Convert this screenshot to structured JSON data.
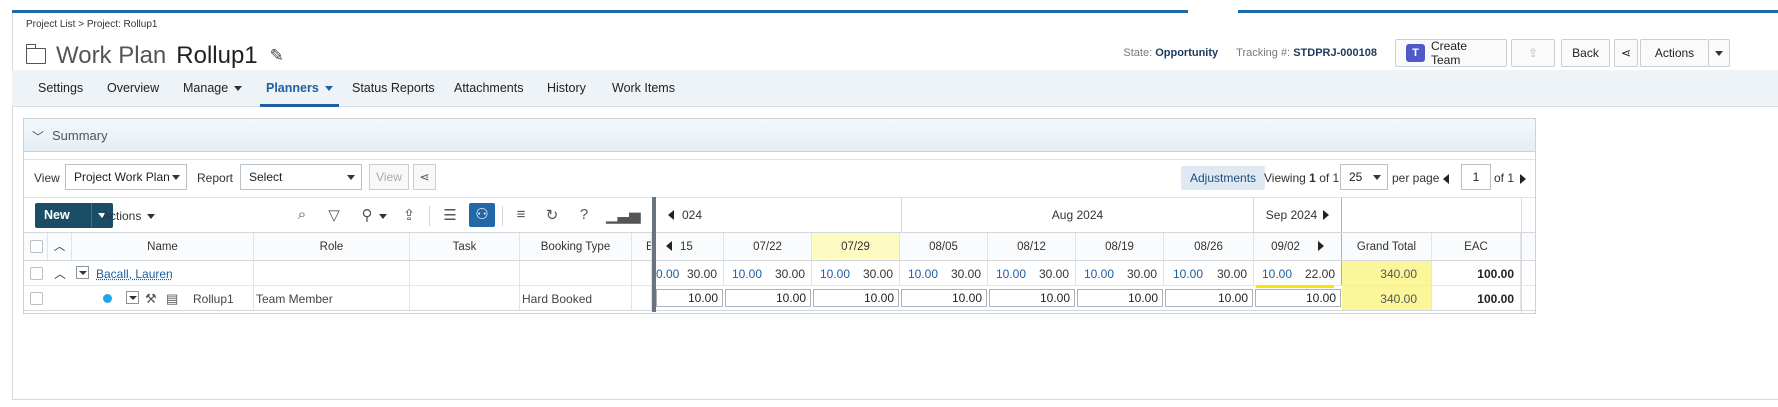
{
  "breadcrumb": "Project List > Project: Rollup1",
  "title": {
    "prefix": "Work Plan",
    "name": "Rollup1"
  },
  "header": {
    "state_label": "State:",
    "state_value": "Opportunity",
    "tracking_label": "Tracking #:",
    "tracking_value": "STDPRJ-000108",
    "create_team": "Create Team",
    "back": "Back",
    "actions": "Actions"
  },
  "tabs": [
    "Settings",
    "Overview",
    "Manage",
    "Planners",
    "Status Reports",
    "Attachments",
    "History",
    "Work Items"
  ],
  "summary": {
    "label": "Summary"
  },
  "viewbar": {
    "view_label": "View",
    "view_select": "Project Work Plan",
    "report_label": "Report",
    "report_select": "Select",
    "view_btn": "View",
    "adjustments": "Adjustments",
    "viewing": "Viewing",
    "viewing_page": "1",
    "viewing_of": "of 1",
    "per_page_value": "25",
    "per_page_label": "per page",
    "page_input": "1",
    "page_of": "of 1"
  },
  "toolbar": {
    "new": "New",
    "actions": "Actions",
    "months": [
      "024",
      "Aug 2024",
      "Sep 2024"
    ]
  },
  "columns": {
    "name": "Name",
    "role": "Role",
    "task": "Task",
    "booking_type": "Booking Type",
    "e": "E",
    "weeks": [
      "15",
      "07/22",
      "07/29",
      "08/05",
      "08/12",
      "08/19",
      "08/26",
      "09/02"
    ],
    "grand_total": "Grand Total",
    "eac": "EAC"
  },
  "rows": [
    {
      "name": "Bacall, Lauren",
      "weeks": [
        [
          "0.00",
          "30.00"
        ],
        [
          "10.00",
          "30.00"
        ],
        [
          "10.00",
          "30.00"
        ],
        [
          "10.00",
          "30.00"
        ],
        [
          "10.00",
          "30.00"
        ],
        [
          "10.00",
          "30.00"
        ],
        [
          "10.00",
          "30.00"
        ],
        [
          "10.00",
          "22.00"
        ]
      ],
      "grand_total": "340.00",
      "eac": "100.00"
    },
    {
      "name": "Rollup1",
      "role": "Team Member",
      "booking_type": "Hard Booked",
      "weeks": [
        "10.00",
        "10.00",
        "10.00",
        "10.00",
        "10.00",
        "10.00",
        "10.00",
        "10.00"
      ],
      "grand_total": "340.00",
      "eac": "100.00"
    }
  ],
  "colors": {
    "primary": "#1f5fa0",
    "new_button": "#1a4e66",
    "highlight": "#fcf69b",
    "current_week": "#fdfbc1"
  }
}
